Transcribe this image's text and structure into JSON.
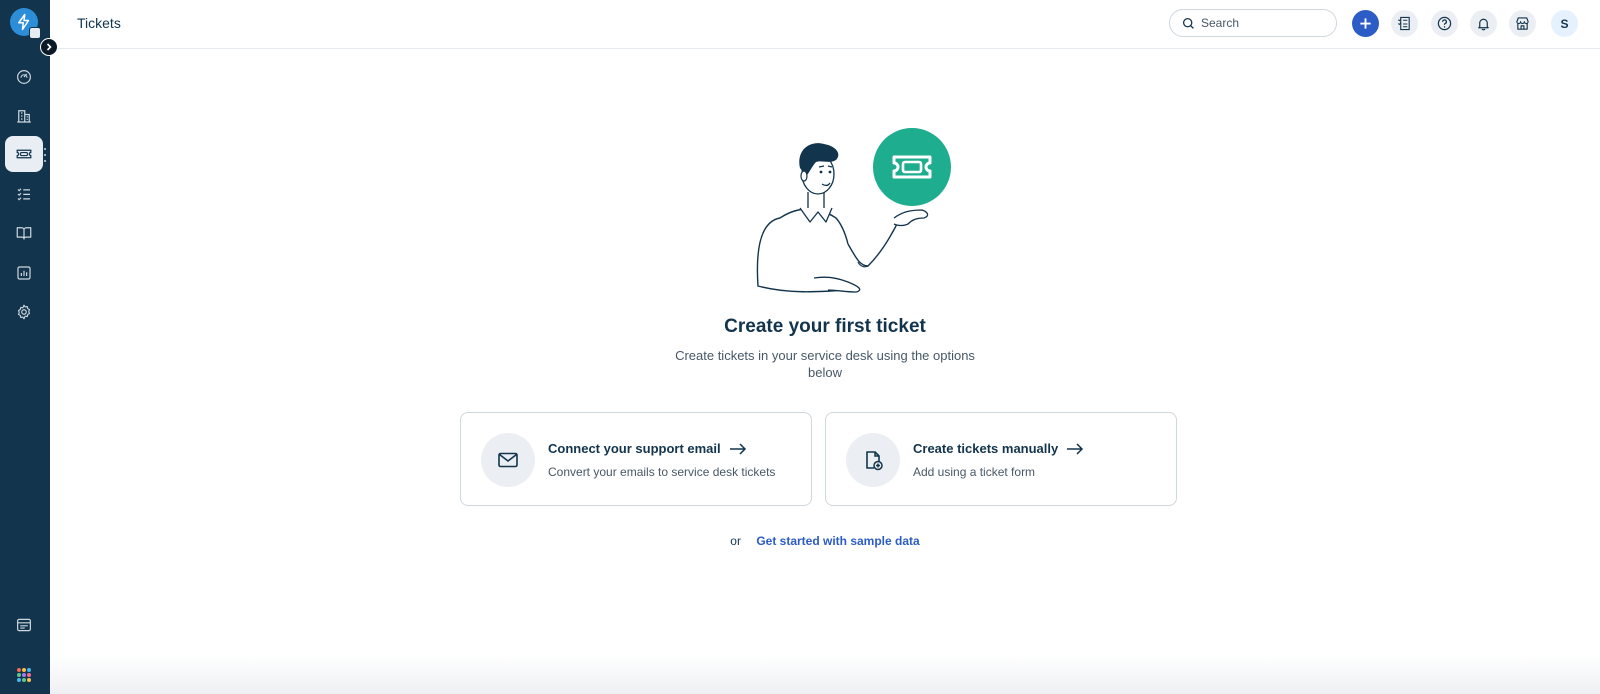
{
  "header": {
    "title": "Tickets",
    "search_placeholder": "Search",
    "avatar_initial": "S"
  },
  "sidebar": {
    "items": [
      {
        "name": "dashboard",
        "icon": "gauge-icon"
      },
      {
        "name": "assets",
        "icon": "building-icon"
      },
      {
        "name": "tickets",
        "icon": "ticket-icon",
        "active": true
      },
      {
        "name": "tasks",
        "icon": "checklist-icon"
      },
      {
        "name": "solutions",
        "icon": "book-icon"
      },
      {
        "name": "analytics",
        "icon": "bar-chart-icon"
      },
      {
        "name": "admin",
        "icon": "gear-icon"
      }
    ],
    "bottom_items": [
      {
        "name": "catalog",
        "icon": "window-icon"
      },
      {
        "name": "apps",
        "icon": "app-grid-icon"
      }
    ]
  },
  "main": {
    "title": "Create your first ticket",
    "subtitle": "Create tickets in your service desk using the options below",
    "cards": [
      {
        "title": "Connect your support email",
        "desc": "Convert your emails to service desk tickets",
        "icon": "envelope-icon"
      },
      {
        "title": "Create tickets manually",
        "desc": "Add using a ticket form",
        "icon": "document-add-icon"
      }
    ],
    "or_text": "or",
    "sample_link": "Get started with sample data"
  },
  "colors": {
    "sidebar_bg": "#12344d",
    "accent_blue": "#2c5cc5",
    "illustration_green": "#1ead8f",
    "text_primary": "#12344d",
    "text_secondary": "#475867"
  }
}
